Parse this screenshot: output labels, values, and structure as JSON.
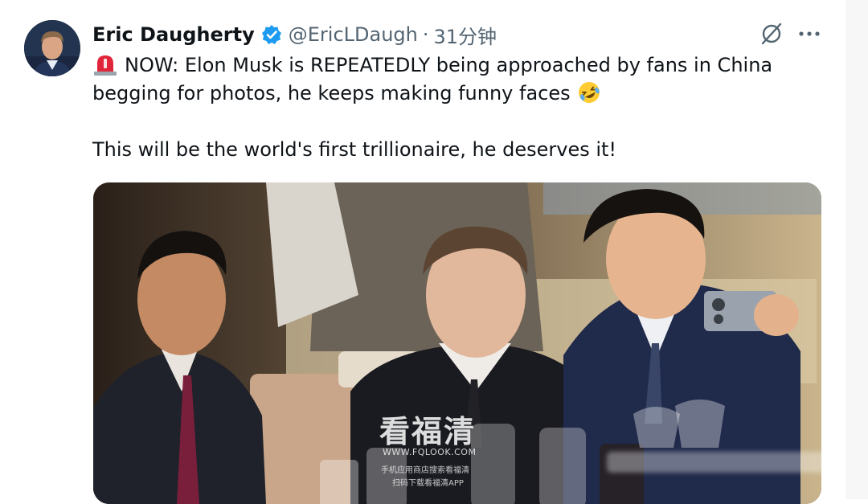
{
  "tweet": {
    "author": {
      "display_name": "Eric Daugherty",
      "handle": "@EricLDaugh",
      "time_ago": "31分钟",
      "verified": true
    },
    "text_para1": "NOW: Elon Musk is REPEATEDLY being approached by fans in China begging for photos, he keeps making funny faces",
    "text_para2": "This will be the world's first trillionaire, he deserves it!",
    "emojis": [
      "rotating-light",
      "rolling-on-floor-laughing"
    ],
    "separator": "·",
    "actions": [
      "grok-icon",
      "more-options-icon"
    ]
  },
  "watermark": {
    "main": "看福清",
    "url": "WWW.FQLOOK.COM",
    "line1": "手机应用商店搜索看福清",
    "line2": "扫码下载看福清APP"
  },
  "colors": {
    "text_primary": "#0f1419",
    "text_secondary": "#536471",
    "verified_blue": "#1d9bf0",
    "background": "#ffffff"
  }
}
